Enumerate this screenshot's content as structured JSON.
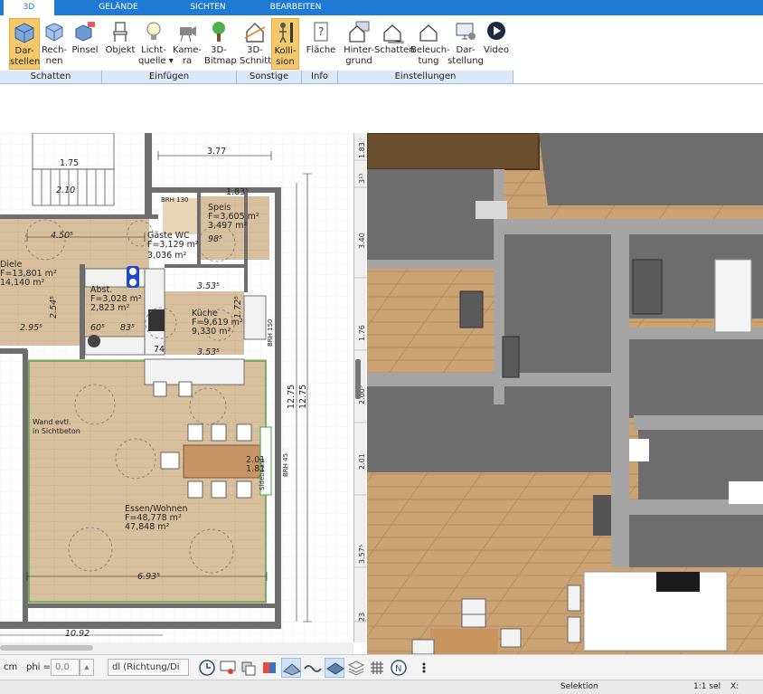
{
  "tabs": [
    {
      "label": "3D"
    },
    {
      "label": "GELÄNDE"
    },
    {
      "label": "SICHTEN"
    },
    {
      "label": "BEARBEITEN"
    }
  ],
  "ribbon": {
    "buttons": [
      {
        "label": "Dar-\nstellen"
      },
      {
        "label": "Rech-\nnen"
      },
      {
        "label": "Pinsel"
      },
      {
        "label": "Objekt"
      },
      {
        "label": "Licht-\nquelle ▾"
      },
      {
        "label": "Kame-\nra"
      },
      {
        "label": "3D-\nBitmap"
      },
      {
        "label": "3D-\nSchnitt"
      },
      {
        "label": "Kolli-\nsion"
      },
      {
        "label": "Fläche"
      },
      {
        "label": "Hinter-\ngrund"
      },
      {
        "label": "Schatten"
      },
      {
        "label": "Beleuch-\ntung"
      },
      {
        "label": "Dar-\nstellung"
      },
      {
        "label": "Video"
      }
    ],
    "groups": [
      {
        "label": "Schatten"
      },
      {
        "label": "Einfügen"
      },
      {
        "label": "Sonstige"
      },
      {
        "label": "Info"
      },
      {
        "label": "Einstellungen"
      }
    ]
  },
  "plan": {
    "rooms": [
      {
        "name": "Diele",
        "area1": "F=13,801 m²",
        "area2": "14,140 m²"
      },
      {
        "name": "Küche",
        "area1": "F=9,619 m²",
        "area2": "9,330 m²"
      },
      {
        "name": "Essen/Wohnen",
        "area1": "F=48,778 m²",
        "area2": "47,848 m²"
      },
      {
        "name": "Speis",
        "area1": "F=3,605 m²",
        "area2": "3,497 m²"
      },
      {
        "name": "Gäste WC",
        "area1": "F=3,129 m²",
        "area2": "3,036 m²"
      },
      {
        "name": "Abst.",
        "area1": "F=3,028 m²",
        "area2": "2,823 m²"
      }
    ],
    "dimensions": {
      "d_377": "3.77",
      "d_450": "4.50⁵",
      "d_295": "2.95⁵",
      "d_353a": "3.53⁵",
      "d_353b": "3.53⁵",
      "d_693": "6.93⁵",
      "d_1092": "10.92",
      "d_210": "2.10",
      "d_175": "1.75",
      "d_183": "1.83⁵",
      "d_1275a": "12.75",
      "d_1275b": "12.75",
      "d_201": "2.01",
      "d_181": "1.81",
      "d_254": "2.54⁵",
      "d_083": "83⁵",
      "d_060": "60⁵",
      "d_074": "74",
      "d_098": "98⁵",
      "d_172": "1.72⁵"
    },
    "notes": {
      "wall_note": "Wand evtl.\nin Sichtbeton",
      "sideboard": "Sideboard",
      "brh45": "BRH 45",
      "brh130": "BRH 130",
      "brh150": "BRH 150"
    }
  },
  "ruler": {
    "ticks": [
      "1.83",
      "3¹³",
      "3.40",
      "1.76",
      "2.00⁵",
      "2.01",
      "3.57⁵",
      "23"
    ]
  },
  "toolbar": {
    "unit": "cm",
    "phi_label": "phi =",
    "phi_value": "0,0",
    "direction_value": "dl (Richtung/Di"
  },
  "status": {
    "mode": "Selektion",
    "scale": "1:1 sel",
    "coord": "X:"
  },
  "colors": {
    "accent": "#1e7ad3",
    "active_button": "#f6c86c",
    "floor": "#cda274",
    "wall3d": "#6a6a6a"
  }
}
